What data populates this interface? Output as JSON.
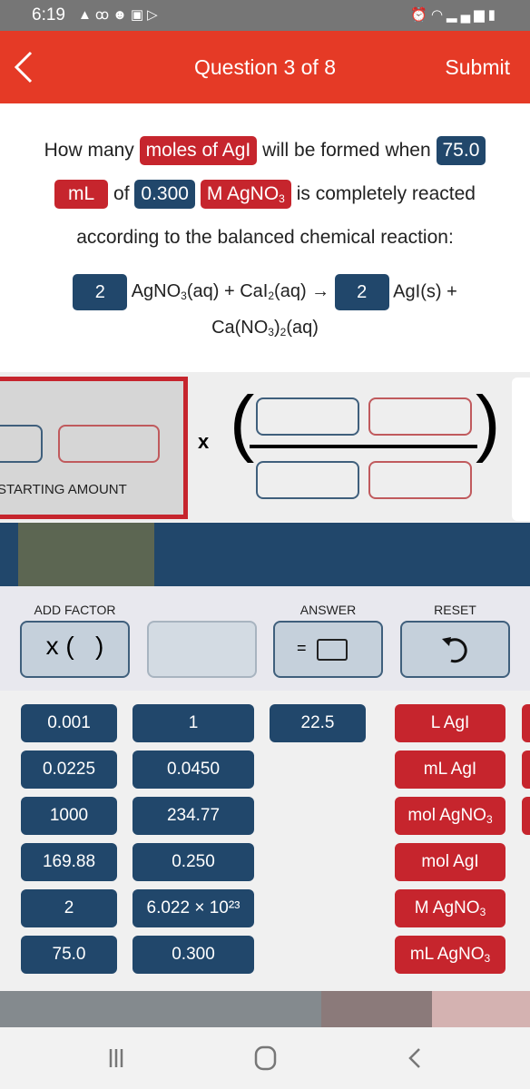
{
  "status_bar": {
    "time": "6:19",
    "left_icons": [
      "warning-icon",
      "voicemail-icon",
      "smiley-icon",
      "image-icon",
      "play-store-icon"
    ],
    "right_icons": [
      "alarm-icon",
      "wifi-icon",
      "signal-icon",
      "battery-icon"
    ]
  },
  "app_bar": {
    "title": "Question 3 of 8",
    "submit_label": "Submit",
    "back_icon": "chevron-left-icon"
  },
  "question": {
    "line1": {
      "pre": "How many",
      "chip_target": "moles of AgI",
      "mid": "will be formed when",
      "chip_volume": "75.0"
    },
    "line2": {
      "chip_unit": "mL",
      "of": "of",
      "chip_conc": "0.300",
      "chip_species_main": "M AgNO",
      "chip_species_sub": "3",
      "post": "is completely reacted"
    },
    "line3": "according to the balanced chemical reaction:",
    "equation": {
      "coef1": "2",
      "reactants_a": "AgNO",
      "reactants_a_sub": "3",
      "reactants_b": "(aq) + CaI",
      "reactants_b_sub": "2",
      "reactants_c": "(aq) →",
      "coef2": "2",
      "product1": "AgI(s) +",
      "product2_a": "Ca(NO",
      "product2_sub1": "3",
      "product2_b": ")",
      "product2_sub2": "2",
      "product2_c": "(aq)"
    }
  },
  "workspace": {
    "starting_amount_label": "STARTING AMOUNT",
    "multiply_symbol": "x"
  },
  "controls": {
    "add_factor_label": "ADD FACTOR",
    "add_factor_glyph": "x (   )",
    "answer_label": "ANSWER",
    "answer_glyph": "=",
    "reset_label": "RESET",
    "reset_icon": "undo-icon"
  },
  "tiles": {
    "numbers_col1": [
      "0.001",
      "0.0225",
      "1000",
      "169.88",
      "2",
      "75.0"
    ],
    "numbers_col2": [
      "1",
      "0.0450",
      "234.77",
      "0.250",
      "6.022 × 10²³",
      "0.300"
    ],
    "numbers_col3": [
      "22.5"
    ],
    "units": [
      {
        "main": "L AgI",
        "sub": ""
      },
      {
        "main": "mL AgI",
        "sub": ""
      },
      {
        "main": "mol AgNO",
        "sub": "3"
      },
      {
        "main": "mol AgI",
        "sub": ""
      },
      {
        "main": "M AgNO",
        "sub": "3"
      },
      {
        "main": "mL AgNO",
        "sub": "3"
      }
    ]
  },
  "colors": {
    "accent_red": "#e53a26",
    "unit_red": "#c6252d",
    "number_blue": "#21476b"
  },
  "nav_bar": {
    "recents_icon": "recents-icon",
    "home_icon": "home-icon",
    "back_icon": "back-icon"
  }
}
